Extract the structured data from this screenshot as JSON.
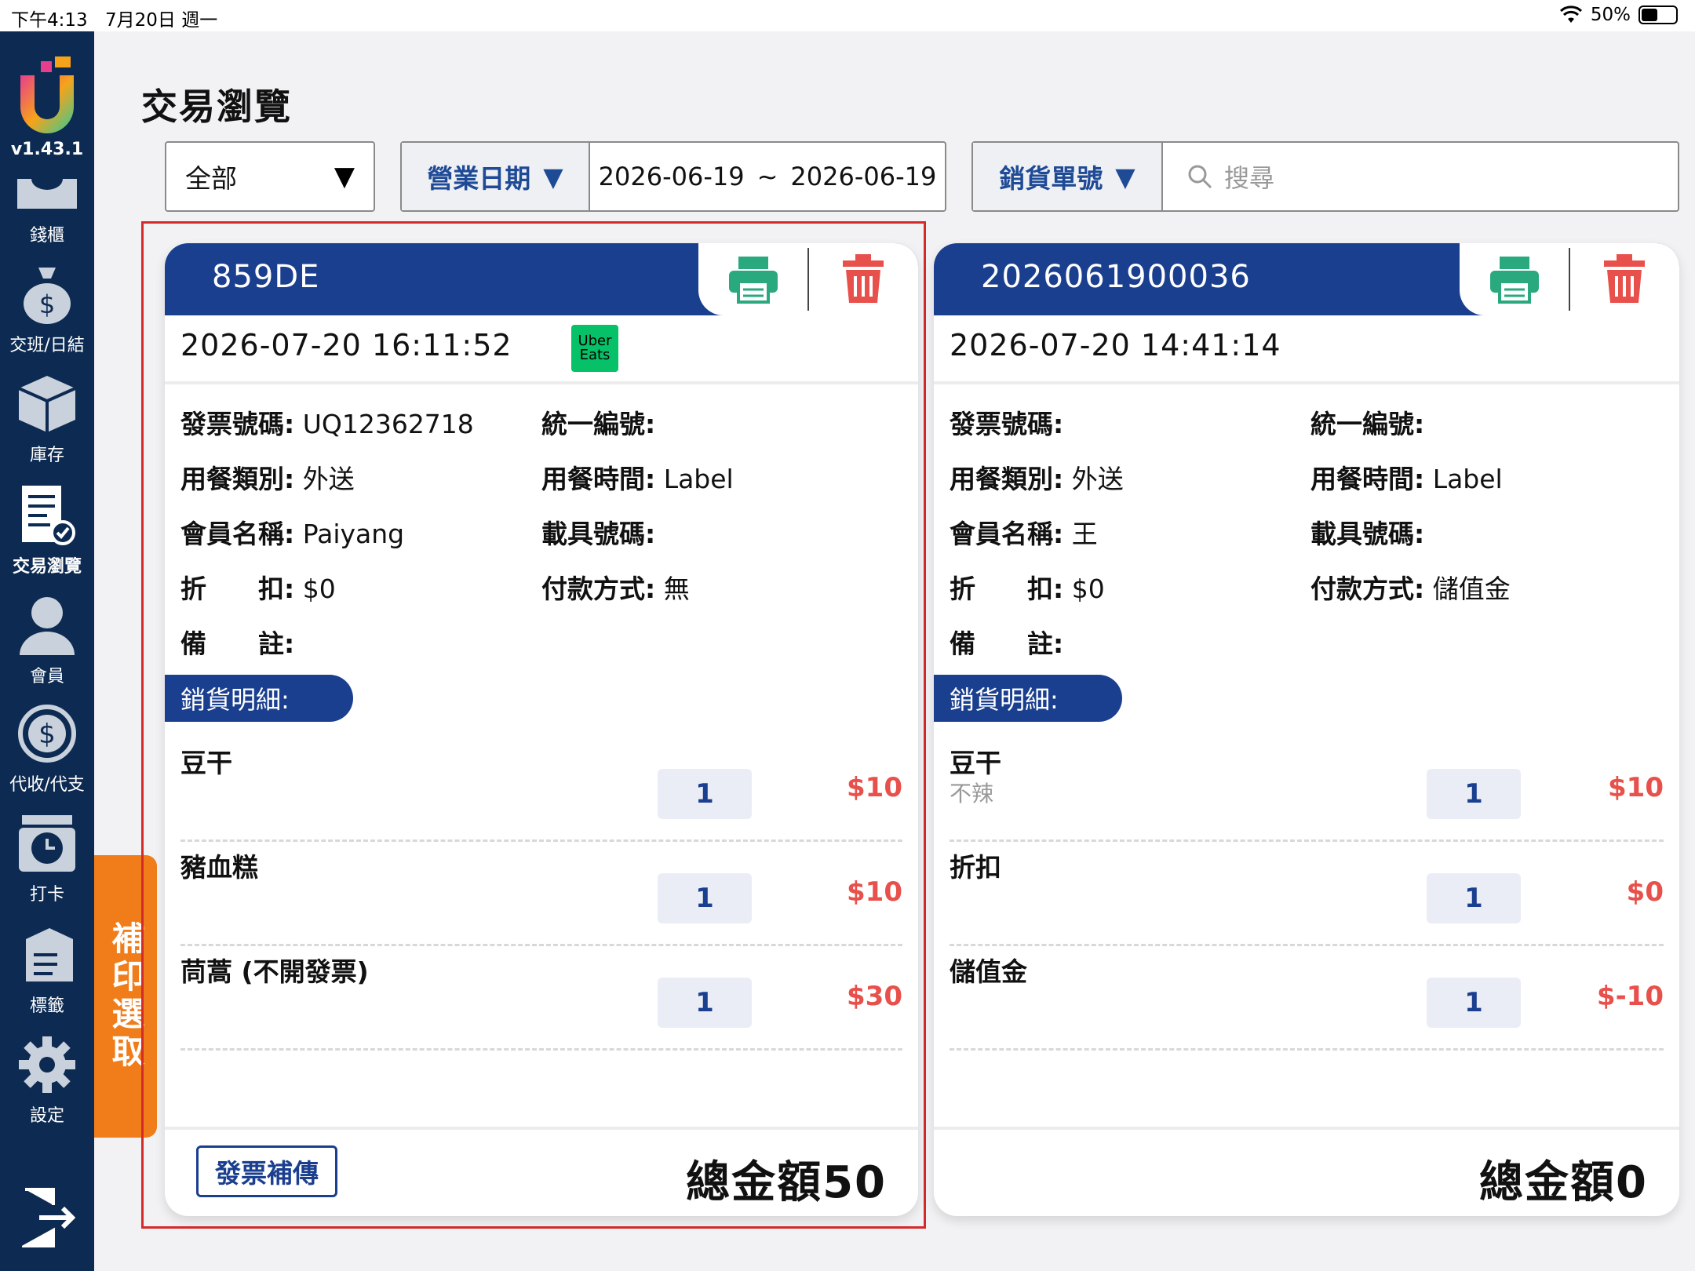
{
  "status_bar": {
    "time": "下午4:13",
    "date": "7月20日 週一",
    "battery": "50%"
  },
  "sidebar": {
    "version": "v1.43.1",
    "items": [
      {
        "label": "錢櫃",
        "icon": "cash-drawer-icon"
      },
      {
        "label": "交班/日結",
        "icon": "money-bag-icon"
      },
      {
        "label": "庫存",
        "icon": "inventory-box-icon"
      },
      {
        "label": "交易瀏覽",
        "icon": "receipt-check-icon"
      },
      {
        "label": "會員",
        "icon": "person-icon"
      },
      {
        "label": "代收/代支",
        "icon": "dollar-cycle-icon"
      },
      {
        "label": "打卡",
        "icon": "clock-in-icon"
      },
      {
        "label": "標籤",
        "icon": "tag-icon"
      },
      {
        "label": "設定",
        "icon": "gear-icon"
      }
    ],
    "active_index": 3,
    "logout_icon": "logout-icon"
  },
  "reprint_tab": "補印選取",
  "page": {
    "title": "交易瀏覽"
  },
  "filters": {
    "type_select": "全部",
    "date_select": "營業日期",
    "date_start": "2026-06-19",
    "date_separator": "~",
    "date_end": "2026-06-19",
    "search_select": "銷貨單號",
    "search_placeholder": "搜尋"
  },
  "labels": {
    "invoice_no": "發票號碼:",
    "tax_id": "統一編號:",
    "dining_type": "用餐類別:",
    "dining_time": "用餐時間:",
    "member_name": "會員名稱:",
    "carrier_no": "載具號碼:",
    "discount": "折　　扣:",
    "payment": "付款方式:",
    "remark": "備　　註:",
    "sales_detail": "銷貨明細:",
    "total_prefix": "總金額",
    "reupload": "發票補傳"
  },
  "transactions": [
    {
      "order_no": "859DE",
      "datetime": "2026-07-20  16:11:52",
      "platform_badge": [
        "Uber",
        "Eats"
      ],
      "invoice_no": "UQ12362718",
      "tax_id": "",
      "dining_type": "外送",
      "dining_time": "Label",
      "member_name": "Paiyang",
      "carrier_no": "",
      "discount": "$0",
      "payment": "無",
      "remark": "",
      "items": [
        {
          "name": "豆干",
          "note": "",
          "qty": "1",
          "price": "$10"
        },
        {
          "name": "豬血糕",
          "note": "",
          "qty": "1",
          "price": "$10"
        },
        {
          "name": "茼蒿 (不開發票)",
          "note": "",
          "qty": "1",
          "price": "$30"
        }
      ],
      "total": "50"
    },
    {
      "order_no": "2026061900036",
      "datetime": "2026-07-20  14:41:14",
      "invoice_no": "",
      "tax_id": "",
      "dining_type": "外送",
      "dining_time": "Label",
      "member_name": "王",
      "carrier_no": "",
      "discount": "$0",
      "payment": "儲值金",
      "remark": "",
      "items": [
        {
          "name": "豆干",
          "note": "不辣",
          "qty": "1",
          "price": "$10"
        },
        {
          "name": "折扣",
          "note": "",
          "qty": "1",
          "price": "$0"
        },
        {
          "name": "儲值金",
          "note": "",
          "qty": "1",
          "price": "$-10"
        }
      ],
      "total": "0"
    }
  ],
  "colors": {
    "sidebar_bg": "#0d2b52",
    "header_blue": "#1b3f8f",
    "print_green": "#2aa87e",
    "delete_red": "#e8504b",
    "reprint_orange": "#f07d1a",
    "selection_red": "#d42a2a"
  }
}
